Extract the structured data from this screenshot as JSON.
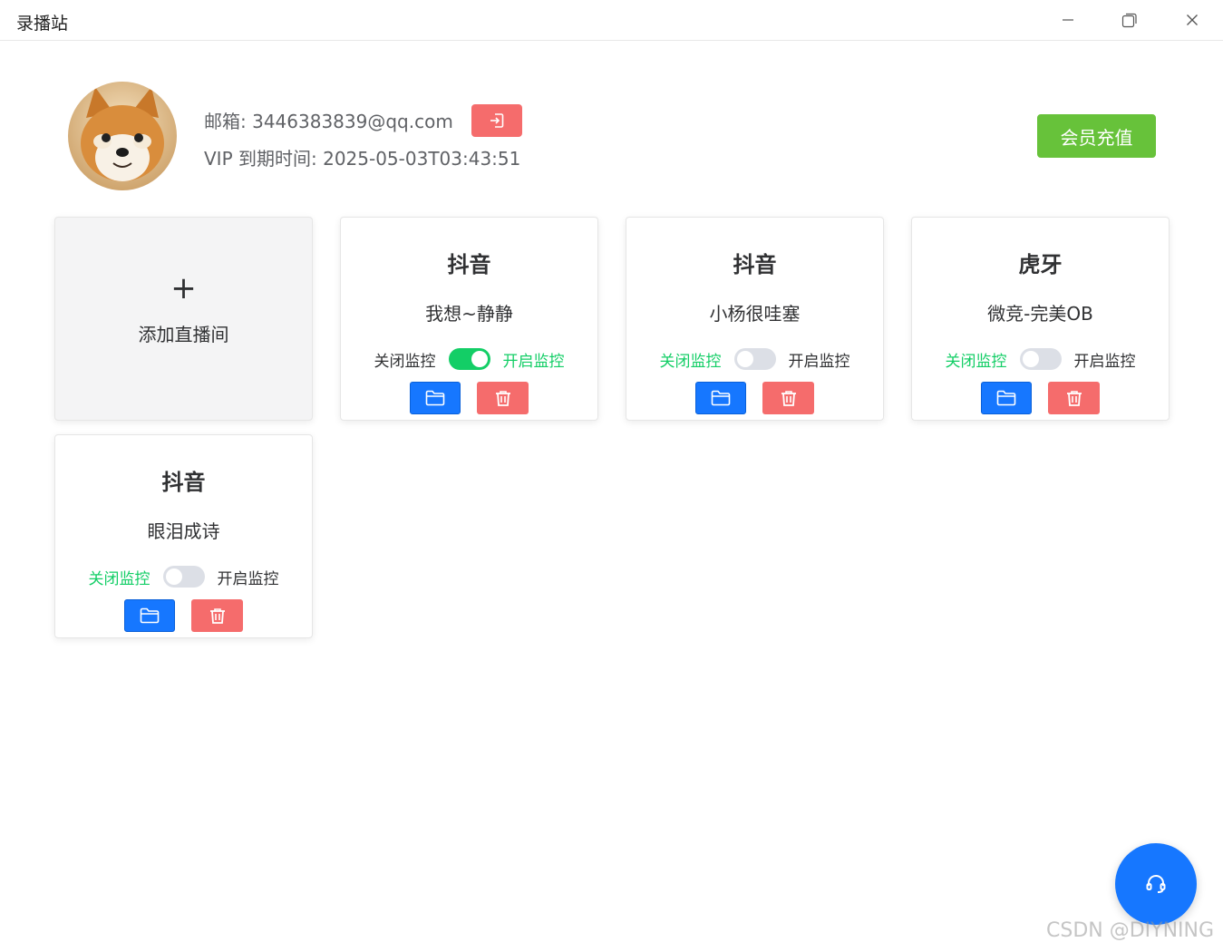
{
  "window": {
    "title": "录播站"
  },
  "profile": {
    "email_text": "邮箱: 3446383839@qq.com",
    "vip_text": "VIP 到期时间: 2025-05-03T03:43:51",
    "recharge_label": "会员充值"
  },
  "add_card": {
    "plus": "+",
    "label": "添加直播间"
  },
  "rooms": [
    {
      "platform": "抖音",
      "name": "我想~静静",
      "off_label": "关闭监控",
      "on_label": "开启监控",
      "monitoring": true
    },
    {
      "platform": "抖音",
      "name": "小杨很哇塞",
      "off_label": "关闭监控",
      "on_label": "开启监控",
      "monitoring": false
    },
    {
      "platform": "虎牙",
      "name": "微竞-完美OB",
      "off_label": "关闭监控",
      "on_label": "开启监控",
      "monitoring": false
    },
    {
      "platform": "抖音",
      "name": "眼泪成诗",
      "off_label": "关闭监控",
      "on_label": "开启监控",
      "monitoring": false
    }
  ],
  "watermark": "CSDN @DIYNING",
  "colors": {
    "primary": "#1677ff",
    "danger": "#f56c6c",
    "success": "#67c23a",
    "switch_on": "#13ce66"
  },
  "icons": [
    "minimize-icon",
    "restore-icon",
    "close-icon",
    "logout-icon",
    "folder-icon",
    "trash-icon",
    "headset-icon",
    "plus-icon"
  ]
}
